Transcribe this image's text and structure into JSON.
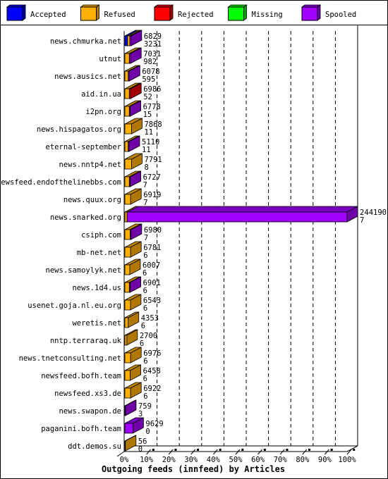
{
  "chart_data": {
    "type": "bar",
    "orientation": "horizontal",
    "stacked": true,
    "style": "3d",
    "title": "Outgoing feeds (innfeed) by Articles",
    "xlim": [
      0,
      100
    ],
    "x_unit": "%",
    "x_ticks": [
      "0%",
      "10%",
      "20%",
      "30%",
      "40%",
      "50%",
      "60%",
      "70%",
      "80%",
      "90%",
      "100%"
    ],
    "grid": true,
    "legend_placement": "top",
    "legend": [
      {
        "name": "Accepted",
        "key": "accepted",
        "color": "#0000ff",
        "side": "#0000a0"
      },
      {
        "name": "Refused",
        "key": "refused",
        "color": "#ffb000",
        "side": "#b07800"
      },
      {
        "name": "Rejected",
        "key": "rejected",
        "color": "#ff0000",
        "side": "#a00000"
      },
      {
        "name": "Missing",
        "key": "missing",
        "color": "#00ff00",
        "side": "#00a000"
      },
      {
        "name": "Spooled",
        "key": "spooled",
        "color": "#a000ff",
        "side": "#7000a8"
      }
    ],
    "rows": [
      {
        "label": "news.chmurka.net",
        "value1": "6829",
        "value2": "3231",
        "segments": {
          "accepted": 1.2,
          "refused": 1.0,
          "spooled": 0.6
        }
      },
      {
        "label": "utnut",
        "value1": "7031",
        "value2": "982",
        "segments": {
          "refused": 2.0,
          "spooled": 0.6
        }
      },
      {
        "label": "news.ausics.net",
        "value1": "6078",
        "value2": "595",
        "segments": {
          "refused": 1.5,
          "spooled": 0.5
        }
      },
      {
        "label": "aid.in.ua",
        "value1": "6986",
        "value2": "52",
        "segments": {
          "refused": 2.0,
          "rejected": 0.6
        }
      },
      {
        "label": "i2pn.org",
        "value1": "6778",
        "value2": "15",
        "segments": {
          "refused": 2.0,
          "spooled": 0.4
        }
      },
      {
        "label": "news.hispagatos.org",
        "value1": "7868",
        "value2": "11",
        "segments": {
          "refused": 3.0
        }
      },
      {
        "label": "eternal-september",
        "value1": "5110",
        "value2": "11",
        "segments": {
          "refused": 1.5,
          "spooled": 0.4
        }
      },
      {
        "label": "news.nntp4.net",
        "value1": "7791",
        "value2": "8",
        "segments": {
          "refused": 3.0
        }
      },
      {
        "label": "newsfeed.endofthelinebbs.com",
        "value1": "6727",
        "value2": "7",
        "segments": {
          "refused": 2.0,
          "spooled": 0.4
        }
      },
      {
        "label": "news.quux.org",
        "value1": "6919",
        "value2": "7",
        "segments": {
          "refused": 2.6
        }
      },
      {
        "label": "news.snarked.org",
        "value1": "244190",
        "value2": "7",
        "segments": {
          "refused": 1.0,
          "spooled": 98.7
        }
      },
      {
        "label": "csiph.com",
        "value1": "6980",
        "value2": "7",
        "segments": {
          "refused": 2.4,
          "spooled": 0.4
        }
      },
      {
        "label": "mb-net.net",
        "value1": "6781",
        "value2": "6",
        "segments": {
          "refused": 2.6
        }
      },
      {
        "label": "news.samoylyk.net",
        "value1": "6007",
        "value2": "6",
        "segments": {
          "refused": 2.2
        }
      },
      {
        "label": "news.1d4.us",
        "value1": "6901",
        "value2": "6",
        "segments": {
          "refused": 2.0,
          "spooled": 0.4
        }
      },
      {
        "label": "usenet.goja.nl.eu.org",
        "value1": "6543",
        "value2": "6",
        "segments": {
          "refused": 2.5
        }
      },
      {
        "label": "weretis.net",
        "value1": "4353",
        "value2": "6",
        "segments": {
          "refused": 1.5
        }
      },
      {
        "label": "nntp.terraraq.uk",
        "value1": "2700",
        "value2": "6",
        "segments": {
          "refused": 0.9
        }
      },
      {
        "label": "news.tnetconsulting.net",
        "value1": "6976",
        "value2": "6",
        "segments": {
          "refused": 2.6
        }
      },
      {
        "label": "newsfeed.bofh.team",
        "value1": "6458",
        "value2": "6",
        "segments": {
          "refused": 2.4
        }
      },
      {
        "label": "newsfeed.xs3.de",
        "value1": "6922",
        "value2": "6",
        "segments": {
          "refused": 2.6
        }
      },
      {
        "label": "news.swapon.de",
        "value1": "759",
        "value2": "3",
        "segments": {
          "spooled": 0.3
        }
      },
      {
        "label": "paganini.bofh.team",
        "value1": "9629",
        "value2": "0",
        "segments": {
          "spooled": 3.6
        }
      },
      {
        "label": "ddt.demos.su",
        "value1": "56",
        "value2": "0",
        "segments": {
          "refused": 0.2
        }
      }
    ]
  }
}
